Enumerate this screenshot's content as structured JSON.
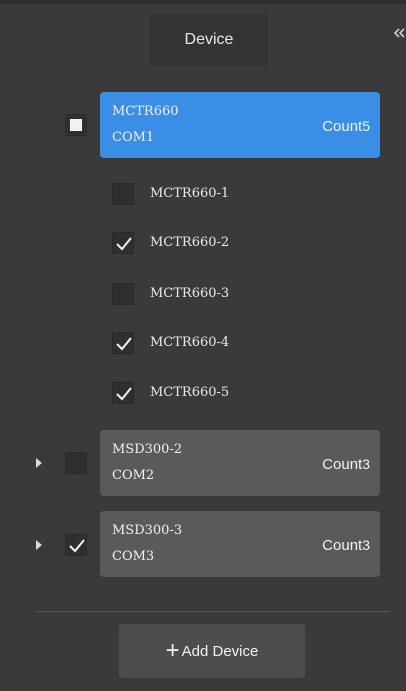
{
  "header": {
    "title": "Device"
  },
  "devices": [
    {
      "name": "MCTR660",
      "port": "COM1",
      "count_label": "Count",
      "count": "5",
      "expanded": true,
      "selected": true,
      "check_state": "partial",
      "children": [
        {
          "name": "MCTR660-1",
          "checked": false
        },
        {
          "name": "MCTR660-2",
          "checked": true
        },
        {
          "name": "MCTR660-3",
          "checked": false
        },
        {
          "name": "MCTR660-4",
          "checked": true
        },
        {
          "name": "MCTR660-5",
          "checked": true
        }
      ]
    },
    {
      "name": "MSD300-2",
      "port": "COM2",
      "count_label": "Count",
      "count": "3",
      "expanded": false,
      "selected": false,
      "check_state": "unchecked"
    },
    {
      "name": "MSD300-3",
      "port": "COM3",
      "count_label": "Count",
      "count": "3",
      "expanded": false,
      "selected": false,
      "check_state": "checked"
    }
  ],
  "footer": {
    "add_plus": "+",
    "add_label": "Add Device"
  },
  "icons": {
    "collapse": "double-chevron-left-icon",
    "expanded": "triangle-down-icon",
    "collapsed": "triangle-right-icon",
    "check": "checkmark-icon"
  },
  "colors": {
    "background": "#3a3a3a",
    "selected_card": "#3a8ee6",
    "card": "#5a5a5a",
    "button": "#4d4d4d",
    "checkbox": "#2f2f2f"
  }
}
